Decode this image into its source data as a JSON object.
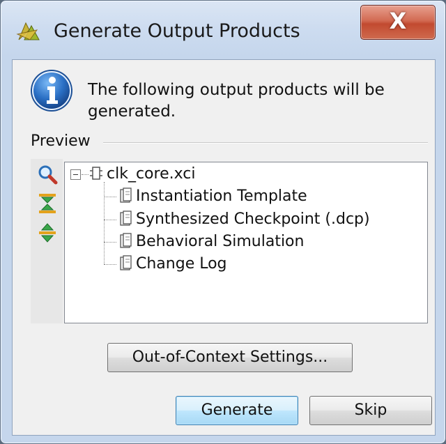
{
  "window": {
    "title": "Generate Output Products",
    "close_label": "X"
  },
  "message": {
    "text": "The following output products will be generated."
  },
  "preview": {
    "label": "Preview"
  },
  "toolbar": {
    "items": [
      {
        "icon": "search-icon"
      },
      {
        "icon": "collapse-all-icon"
      },
      {
        "icon": "expand-all-icon"
      }
    ]
  },
  "tree": {
    "root": {
      "label": "clk_core.xci",
      "expanded": true,
      "icon": "ip-core-icon"
    },
    "children": [
      {
        "label": "Instantiation Template",
        "icon": "file-icon"
      },
      {
        "label": "Synthesized Checkpoint (.dcp)",
        "icon": "file-icon"
      },
      {
        "label": "Behavioral Simulation",
        "icon": "file-icon"
      },
      {
        "label": "Change Log",
        "icon": "file-icon"
      }
    ]
  },
  "buttons": {
    "ooc_settings": "Out-of-Context Settings...",
    "generate": "Generate",
    "skip": "Skip"
  },
  "colors": {
    "info_blue": "#2a6fc4",
    "close_red": "#c24a30",
    "default_button_border": "#3c7fb1"
  }
}
